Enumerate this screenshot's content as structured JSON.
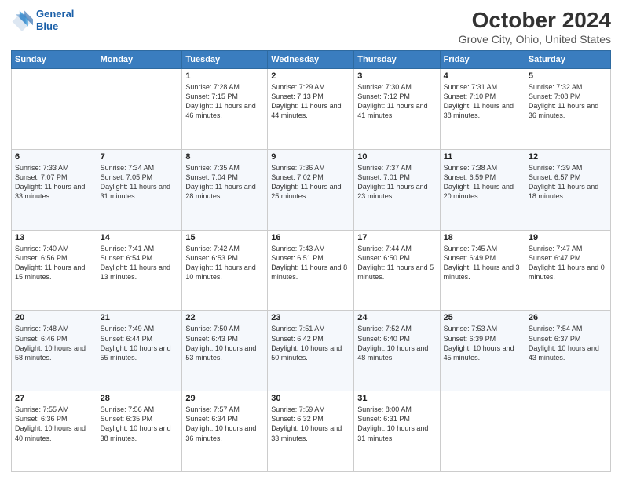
{
  "header": {
    "logo_line1": "General",
    "logo_line2": "Blue",
    "title": "October 2024",
    "subtitle": "Grove City, Ohio, United States"
  },
  "days_of_week": [
    "Sunday",
    "Monday",
    "Tuesday",
    "Wednesday",
    "Thursday",
    "Friday",
    "Saturday"
  ],
  "weeks": [
    [
      {
        "day": "",
        "sunrise": "",
        "sunset": "",
        "daylight": ""
      },
      {
        "day": "",
        "sunrise": "",
        "sunset": "",
        "daylight": ""
      },
      {
        "day": "1",
        "sunrise": "Sunrise: 7:28 AM",
        "sunset": "Sunset: 7:15 PM",
        "daylight": "Daylight: 11 hours and 46 minutes."
      },
      {
        "day": "2",
        "sunrise": "Sunrise: 7:29 AM",
        "sunset": "Sunset: 7:13 PM",
        "daylight": "Daylight: 11 hours and 44 minutes."
      },
      {
        "day": "3",
        "sunrise": "Sunrise: 7:30 AM",
        "sunset": "Sunset: 7:12 PM",
        "daylight": "Daylight: 11 hours and 41 minutes."
      },
      {
        "day": "4",
        "sunrise": "Sunrise: 7:31 AM",
        "sunset": "Sunset: 7:10 PM",
        "daylight": "Daylight: 11 hours and 38 minutes."
      },
      {
        "day": "5",
        "sunrise": "Sunrise: 7:32 AM",
        "sunset": "Sunset: 7:08 PM",
        "daylight": "Daylight: 11 hours and 36 minutes."
      }
    ],
    [
      {
        "day": "6",
        "sunrise": "Sunrise: 7:33 AM",
        "sunset": "Sunset: 7:07 PM",
        "daylight": "Daylight: 11 hours and 33 minutes."
      },
      {
        "day": "7",
        "sunrise": "Sunrise: 7:34 AM",
        "sunset": "Sunset: 7:05 PM",
        "daylight": "Daylight: 11 hours and 31 minutes."
      },
      {
        "day": "8",
        "sunrise": "Sunrise: 7:35 AM",
        "sunset": "Sunset: 7:04 PM",
        "daylight": "Daylight: 11 hours and 28 minutes."
      },
      {
        "day": "9",
        "sunrise": "Sunrise: 7:36 AM",
        "sunset": "Sunset: 7:02 PM",
        "daylight": "Daylight: 11 hours and 25 minutes."
      },
      {
        "day": "10",
        "sunrise": "Sunrise: 7:37 AM",
        "sunset": "Sunset: 7:01 PM",
        "daylight": "Daylight: 11 hours and 23 minutes."
      },
      {
        "day": "11",
        "sunrise": "Sunrise: 7:38 AM",
        "sunset": "Sunset: 6:59 PM",
        "daylight": "Daylight: 11 hours and 20 minutes."
      },
      {
        "day": "12",
        "sunrise": "Sunrise: 7:39 AM",
        "sunset": "Sunset: 6:57 PM",
        "daylight": "Daylight: 11 hours and 18 minutes."
      }
    ],
    [
      {
        "day": "13",
        "sunrise": "Sunrise: 7:40 AM",
        "sunset": "Sunset: 6:56 PM",
        "daylight": "Daylight: 11 hours and 15 minutes."
      },
      {
        "day": "14",
        "sunrise": "Sunrise: 7:41 AM",
        "sunset": "Sunset: 6:54 PM",
        "daylight": "Daylight: 11 hours and 13 minutes."
      },
      {
        "day": "15",
        "sunrise": "Sunrise: 7:42 AM",
        "sunset": "Sunset: 6:53 PM",
        "daylight": "Daylight: 11 hours and 10 minutes."
      },
      {
        "day": "16",
        "sunrise": "Sunrise: 7:43 AM",
        "sunset": "Sunset: 6:51 PM",
        "daylight": "Daylight: 11 hours and 8 minutes."
      },
      {
        "day": "17",
        "sunrise": "Sunrise: 7:44 AM",
        "sunset": "Sunset: 6:50 PM",
        "daylight": "Daylight: 11 hours and 5 minutes."
      },
      {
        "day": "18",
        "sunrise": "Sunrise: 7:45 AM",
        "sunset": "Sunset: 6:49 PM",
        "daylight": "Daylight: 11 hours and 3 minutes."
      },
      {
        "day": "19",
        "sunrise": "Sunrise: 7:47 AM",
        "sunset": "Sunset: 6:47 PM",
        "daylight": "Daylight: 11 hours and 0 minutes."
      }
    ],
    [
      {
        "day": "20",
        "sunrise": "Sunrise: 7:48 AM",
        "sunset": "Sunset: 6:46 PM",
        "daylight": "Daylight: 10 hours and 58 minutes."
      },
      {
        "day": "21",
        "sunrise": "Sunrise: 7:49 AM",
        "sunset": "Sunset: 6:44 PM",
        "daylight": "Daylight: 10 hours and 55 minutes."
      },
      {
        "day": "22",
        "sunrise": "Sunrise: 7:50 AM",
        "sunset": "Sunset: 6:43 PM",
        "daylight": "Daylight: 10 hours and 53 minutes."
      },
      {
        "day": "23",
        "sunrise": "Sunrise: 7:51 AM",
        "sunset": "Sunset: 6:42 PM",
        "daylight": "Daylight: 10 hours and 50 minutes."
      },
      {
        "day": "24",
        "sunrise": "Sunrise: 7:52 AM",
        "sunset": "Sunset: 6:40 PM",
        "daylight": "Daylight: 10 hours and 48 minutes."
      },
      {
        "day": "25",
        "sunrise": "Sunrise: 7:53 AM",
        "sunset": "Sunset: 6:39 PM",
        "daylight": "Daylight: 10 hours and 45 minutes."
      },
      {
        "day": "26",
        "sunrise": "Sunrise: 7:54 AM",
        "sunset": "Sunset: 6:37 PM",
        "daylight": "Daylight: 10 hours and 43 minutes."
      }
    ],
    [
      {
        "day": "27",
        "sunrise": "Sunrise: 7:55 AM",
        "sunset": "Sunset: 6:36 PM",
        "daylight": "Daylight: 10 hours and 40 minutes."
      },
      {
        "day": "28",
        "sunrise": "Sunrise: 7:56 AM",
        "sunset": "Sunset: 6:35 PM",
        "daylight": "Daylight: 10 hours and 38 minutes."
      },
      {
        "day": "29",
        "sunrise": "Sunrise: 7:57 AM",
        "sunset": "Sunset: 6:34 PM",
        "daylight": "Daylight: 10 hours and 36 minutes."
      },
      {
        "day": "30",
        "sunrise": "Sunrise: 7:59 AM",
        "sunset": "Sunset: 6:32 PM",
        "daylight": "Daylight: 10 hours and 33 minutes."
      },
      {
        "day": "31",
        "sunrise": "Sunrise: 8:00 AM",
        "sunset": "Sunset: 6:31 PM",
        "daylight": "Daylight: 10 hours and 31 minutes."
      },
      {
        "day": "",
        "sunrise": "",
        "sunset": "",
        "daylight": ""
      },
      {
        "day": "",
        "sunrise": "",
        "sunset": "",
        "daylight": ""
      }
    ]
  ]
}
